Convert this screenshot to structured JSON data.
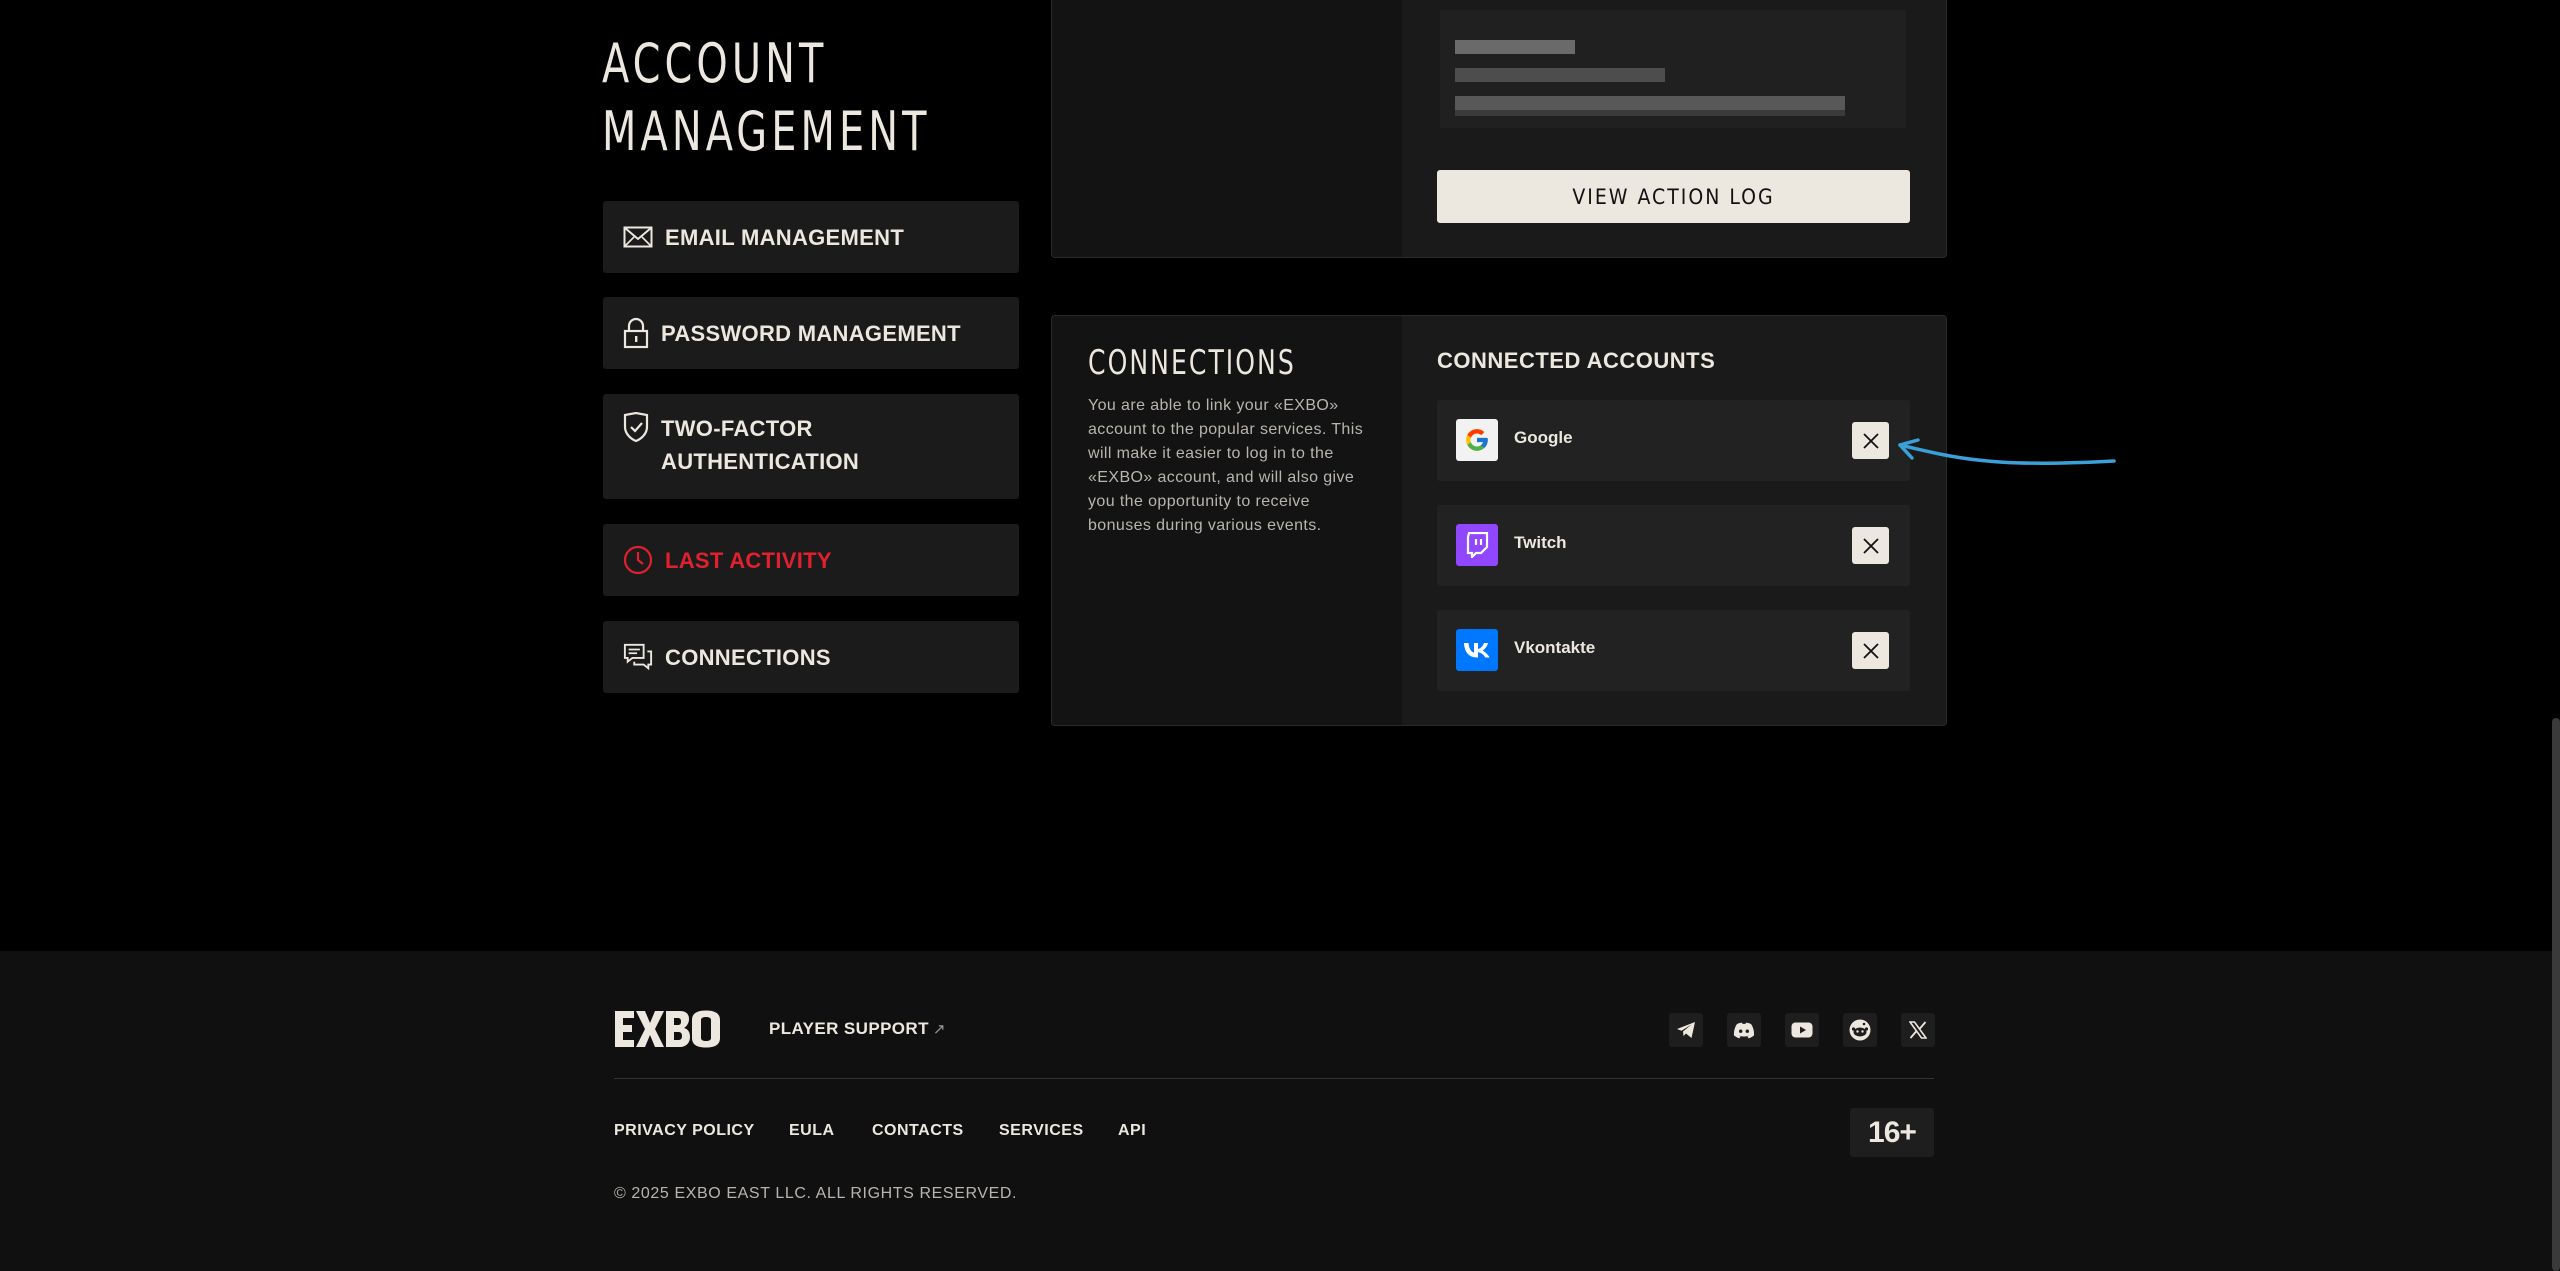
{
  "page": {
    "title_line1": "ACCOUNT",
    "title_line2": "MANAGEMENT"
  },
  "sidebar": {
    "items": [
      {
        "label": "EMAIL MANAGEMENT",
        "icon": "envelope-icon"
      },
      {
        "label": "PASSWORD MANAGEMENT",
        "icon": "lock-icon"
      },
      {
        "label_line1": "TWO-FACTOR",
        "label_line2": "AUTHENTICATION",
        "icon": "shield-check-icon"
      },
      {
        "label": "LAST ACTIVITY",
        "icon": "clock-icon",
        "active": true
      },
      {
        "label": "CONNECTIONS",
        "icon": "chat-bubbles-icon"
      }
    ],
    "active_color": "#e0202f"
  },
  "activity": {
    "action_log_button": "VIEW ACTION LOG"
  },
  "connections": {
    "title": "CONNECTIONS",
    "description": "You are able to link your «EXBO» account to the popular services. This will make it easier to log in to the «EXBO» account, and will also give you the opportunity to receive bonuses during various events.",
    "connected_title": "CONNECTED ACCOUNTS",
    "accounts": [
      {
        "name": "Google",
        "icon": "google-icon",
        "color": "#ffffff"
      },
      {
        "name": "Twitch",
        "icon": "twitch-icon",
        "color": "#9146ff"
      },
      {
        "name": "Vkontakte",
        "icon": "vk-icon",
        "color": "#0077ff"
      }
    ]
  },
  "footer": {
    "brand": "EXBO",
    "support_label": "PLAYER SUPPORT",
    "support_arrow": "↗",
    "socials": [
      "telegram-icon",
      "discord-icon",
      "youtube-icon",
      "reddit-icon",
      "x-icon"
    ],
    "links": [
      "PRIVACY POLICY",
      "EULA",
      "CONTACTS",
      "SERVICES",
      "API"
    ],
    "copyright": "© 2025 EXBO EAST LLC. ALL RIGHTS RESERVED.",
    "age_rating": "16+"
  },
  "annotation": {
    "color": "#3aa0d8"
  }
}
